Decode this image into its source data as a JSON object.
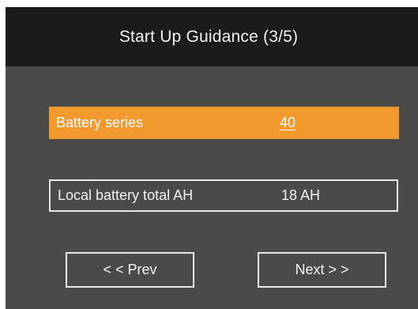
{
  "header": {
    "title": "Start Up Guidance (3/5)"
  },
  "settings": [
    {
      "label": "Battery series",
      "value": "40"
    },
    {
      "label": "Local battery total AH",
      "value": "18 AH"
    }
  ],
  "buttons": {
    "prev_label": "< < Prev",
    "next_label": "Next > >"
  },
  "colors": {
    "title_bar": "#1d1b19",
    "panel": "#4a4a49",
    "highlight": "#f39a2e",
    "text": "#f2f2f2"
  }
}
